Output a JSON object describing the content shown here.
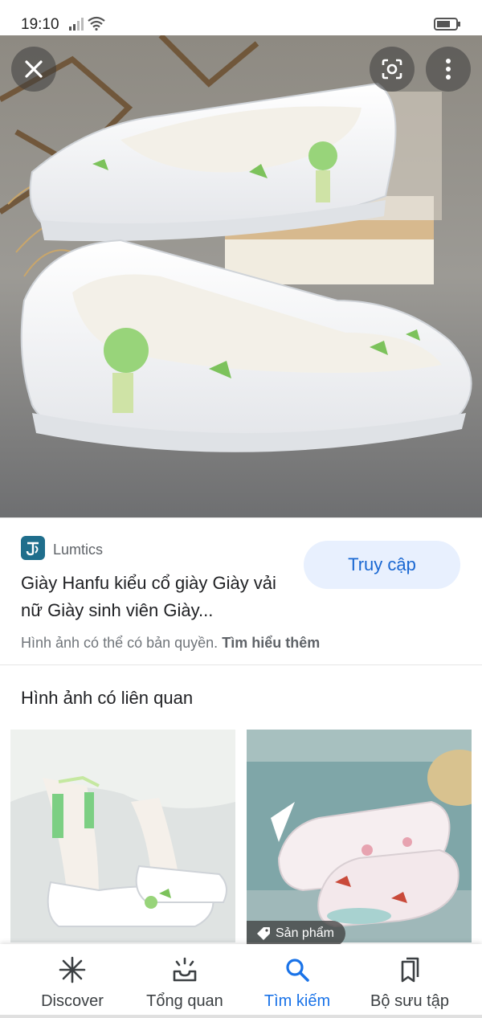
{
  "status_bar": {
    "time": "19:10",
    "icons": [
      "signal-icon",
      "wifi-icon",
      "battery-icon"
    ]
  },
  "viewer": {
    "icons": [
      "close-icon",
      "lens-icon",
      "more-vert-icon"
    ]
  },
  "result": {
    "source_name": "Lumtics",
    "title": "Giày Hanfu kiểu cổ giày Giày vải nữ Giày sinh viên Giày...",
    "visit_label": "Truy cập",
    "copyright_text": "Hình ảnh có thể có bản quyền.",
    "learn_more": "Tìm hiểu thêm"
  },
  "related": {
    "heading": "Hình ảnh có liên quan",
    "product_badge": "Sản phẩm"
  },
  "bottom_nav": {
    "items": [
      {
        "label": "Discover",
        "icon": "discover-icon"
      },
      {
        "label": "Tổng quan",
        "icon": "overview-icon"
      },
      {
        "label": "Tìm kiếm",
        "icon": "search-icon"
      },
      {
        "label": "Bộ sưu tập",
        "icon": "collections-icon"
      }
    ],
    "active_index": 2
  },
  "colors": {
    "accent": "#1a73e8",
    "visit_button_bg": "#e8f0fe",
    "source_logo": "#1f6e8c"
  }
}
